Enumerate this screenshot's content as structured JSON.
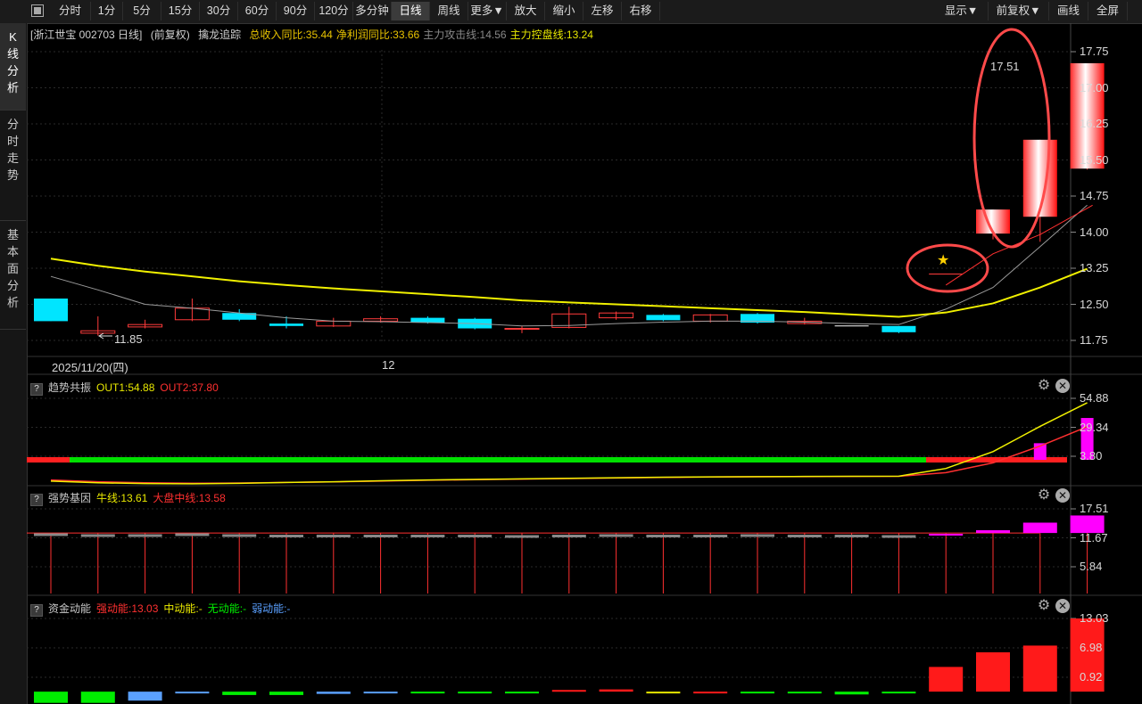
{
  "toolbar": {
    "items": [
      "分时",
      "1分",
      "5分",
      "15分",
      "30分",
      "60分",
      "90分",
      "120分",
      "多分钟",
      "日线",
      "周线",
      "更多▼",
      "放大",
      "缩小",
      "左移",
      "右移"
    ],
    "active": "日线",
    "right_items": [
      "显示▼",
      "前复权▼",
      "画线",
      "全屏"
    ]
  },
  "sidebar": {
    "tabs": [
      {
        "label": "K\n线\n分\n析",
        "active": true
      },
      {
        "label": "分\n时\n走\n势",
        "active": false
      },
      {
        "label": "基\n本\n面\n分\n析",
        "active": false
      }
    ]
  },
  "main": {
    "stock_label": "[浙江世宝 002703 日线]",
    "adjust": "(前复权)",
    "indicator_name": "擒龙追踪",
    "stats": [
      {
        "text": "总收入同比:35.44",
        "color": "#e8c300"
      },
      {
        "text": "净利润同比:33.66",
        "color": "#e8c300"
      },
      {
        "text": "主力攻击线:14.56",
        "color": "#888888"
      },
      {
        "text": "主力控盘线:13.24",
        "color": "#e8e800"
      }
    ],
    "y_ticks": [
      "17.75",
      "17.00",
      "16.25",
      "15.50",
      "14.75",
      "14.00",
      "13.25",
      "12.50",
      "11.75"
    ],
    "high_label": "17.51",
    "low_label": "11.85",
    "date_label": "2025/11/20(四)",
    "month_label": "12"
  },
  "chart_data": {
    "type": "candlestick",
    "ylim": [
      11.75,
      17.75
    ],
    "candles": [
      {
        "o": 12.15,
        "c": 12.62,
        "h": 12.62,
        "l": 12.15,
        "up": false
      },
      {
        "o": 11.9,
        "c": 11.95,
        "h": 12.25,
        "l": 11.85,
        "up": true
      },
      {
        "o": 12.03,
        "c": 12.08,
        "h": 12.18,
        "l": 12.0,
        "up": true
      },
      {
        "o": 12.18,
        "c": 12.42,
        "h": 12.62,
        "l": 12.15,
        "up": true
      },
      {
        "o": 12.32,
        "c": 12.18,
        "h": 12.4,
        "l": 12.15,
        "up": false
      },
      {
        "o": 12.1,
        "c": 12.05,
        "h": 12.25,
        "l": 12.0,
        "up": false
      },
      {
        "o": 12.05,
        "c": 12.15,
        "h": 12.22,
        "l": 12.03,
        "up": true
      },
      {
        "o": 12.15,
        "c": 12.2,
        "h": 12.25,
        "l": 12.12,
        "up": true
      },
      {
        "o": 12.22,
        "c": 12.12,
        "h": 12.25,
        "l": 12.1,
        "up": false
      },
      {
        "o": 12.2,
        "c": 12.0,
        "h": 12.22,
        "l": 11.98,
        "up": false
      },
      {
        "o": 11.98,
        "c": 12.0,
        "h": 12.05,
        "l": 11.9,
        "up": true
      },
      {
        "o": 12.02,
        "c": 12.3,
        "h": 12.45,
        "l": 12.0,
        "up": true
      },
      {
        "o": 12.22,
        "c": 12.32,
        "h": 12.35,
        "l": 12.18,
        "up": true
      },
      {
        "o": 12.28,
        "c": 12.17,
        "h": 12.3,
        "l": 12.15,
        "up": false
      },
      {
        "o": 12.15,
        "c": 12.28,
        "h": 12.3,
        "l": 12.12,
        "up": true
      },
      {
        "o": 12.3,
        "c": 12.12,
        "h": 12.32,
        "l": 12.1,
        "up": false
      },
      {
        "o": 12.1,
        "c": 12.15,
        "h": 12.22,
        "l": 12.08,
        "up": true
      },
      {
        "o": 12.05,
        "c": 12.05,
        "h": 12.05,
        "l": 12.05,
        "up": true
      },
      {
        "o": 12.05,
        "c": 11.92,
        "h": 12.05,
        "l": 11.9,
        "up": false
      },
      {
        "o": 13.13,
        "c": 13.13,
        "h": 13.13,
        "l": 13.13,
        "up": true
      },
      {
        "o": 13.97,
        "c": 14.47,
        "h": 14.47,
        "l": 13.85,
        "up": true
      },
      {
        "o": 14.32,
        "c": 15.92,
        "h": 15.92,
        "l": 13.8,
        "up": true
      },
      {
        "o": 15.32,
        "c": 17.51,
        "h": 17.51,
        "l": 15.3,
        "up": true
      }
    ],
    "ma_yellow": [
      13.45,
      13.3,
      13.18,
      13.08,
      12.98,
      12.9,
      12.83,
      12.77,
      12.71,
      12.65,
      12.58,
      12.54,
      12.5,
      12.46,
      12.42,
      12.38,
      12.34,
      12.29,
      12.24,
      12.33,
      12.52,
      12.85,
      13.24
    ],
    "ma_gray": [
      13.08,
      12.8,
      12.5,
      12.42,
      12.32,
      12.22,
      12.15,
      12.14,
      12.12,
      12.1,
      12.05,
      12.06,
      12.1,
      12.13,
      12.15,
      12.15,
      12.13,
      12.1,
      12.08,
      12.4,
      12.85,
      13.7,
      14.56
    ],
    "star_label": "★"
  },
  "panel1": {
    "name": "趋势共振",
    "out1": "OUT1:54.88",
    "out2": "OUT2:37.80",
    "y_ticks": [
      "54.88",
      "29.34",
      "3.80"
    ],
    "ylim": [
      -3,
      58
    ],
    "out1_line": [
      -1.0,
      -2.2,
      -2.8,
      -2.9,
      -2.6,
      -2.0,
      -1.5,
      -0.8,
      -0.2,
      0.2,
      0.6,
      1.0,
      1.4,
      1.8,
      2.0,
      2.2,
      2.3,
      2.4,
      2.5,
      8.0,
      20.0,
      38.0,
      54.88
    ],
    "out2_line": [
      -0.2,
      -1.5,
      -2.2,
      -2.5,
      -2.4,
      -2.0,
      -1.6,
      -1.0,
      -0.4,
      0.0,
      0.4,
      0.8,
      1.2,
      1.6,
      1.9,
      2.1,
      2.2,
      2.3,
      2.4,
      5.0,
      12.0,
      24.0,
      37.8
    ],
    "bars": [
      0,
      0,
      0,
      0,
      0,
      0,
      0,
      0,
      0,
      0,
      0,
      0,
      0,
      0,
      0,
      0,
      0,
      0,
      0,
      0,
      12,
      26,
      44
    ]
  },
  "panel2": {
    "name": "强势基因",
    "niu": "牛线:13.61",
    "dapan": "大盘中线:13.58",
    "y_ticks": [
      "17.51",
      "11.67",
      "5.84"
    ],
    "ylim": [
      0,
      19
    ],
    "level": 13.58,
    "gray_bars": [
      13.1,
      12.9,
      12.9,
      13.1,
      12.9,
      12.8,
      12.8,
      12.8,
      12.8,
      12.8,
      12.7,
      12.8,
      12.9,
      12.8,
      12.8,
      12.9,
      12.8,
      12.8,
      12.7,
      0,
      0,
      0,
      0
    ],
    "magenta_bars": [
      0,
      0,
      0,
      0,
      0,
      0,
      0,
      0,
      0,
      0,
      0,
      0,
      0,
      0,
      0,
      0,
      0,
      0,
      0,
      13.4,
      14.2,
      15.9,
      17.51
    ]
  },
  "panel3": {
    "name": "资金动能",
    "strong": "强动能:13.03",
    "mid": "中动能:-",
    "none": "无动能:-",
    "weak": "弱动能:-",
    "y_ticks": [
      "13.03",
      "6.98",
      "0.92"
    ],
    "ylim": [
      -2.2,
      13.03
    ],
    "bars": [
      {
        "v": -2.0,
        "c": "#00ee00"
      },
      {
        "v": -2.0,
        "c": "#00ee00"
      },
      {
        "v": -1.6,
        "c": "#5aa0ff"
      },
      {
        "v": -0.2,
        "c": "#5aa0ff"
      },
      {
        "v": -0.6,
        "c": "#00ee00"
      },
      {
        "v": -0.6,
        "c": "#00ee00"
      },
      {
        "v": -0.4,
        "c": "#5aa0ff"
      },
      {
        "v": -0.1,
        "c": "#5aa0ff"
      },
      {
        "v": -0.1,
        "c": "#00ee00"
      },
      {
        "v": -0.3,
        "c": "#00ee00"
      },
      {
        "v": -0.3,
        "c": "#00ee00"
      },
      {
        "v": 0.3,
        "c": "#ff1a1a"
      },
      {
        "v": 0.4,
        "c": "#ff1a1a"
      },
      {
        "v": -0.1,
        "c": "#e8e800"
      },
      {
        "v": -0.1,
        "c": "#ff1a1a"
      },
      {
        "v": -0.1,
        "c": "#00ee00"
      },
      {
        "v": -0.1,
        "c": "#00ee00"
      },
      {
        "v": -0.5,
        "c": "#00ee00"
      },
      {
        "v": 0,
        "c": "#00ee00"
      },
      {
        "v": 4.4,
        "c": "#ff1a1a"
      },
      {
        "v": 7.0,
        "c": "#ff1a1a"
      },
      {
        "v": 8.2,
        "c": "#ff1a1a"
      },
      {
        "v": 13.03,
        "c": "#ff1a1a"
      }
    ]
  }
}
